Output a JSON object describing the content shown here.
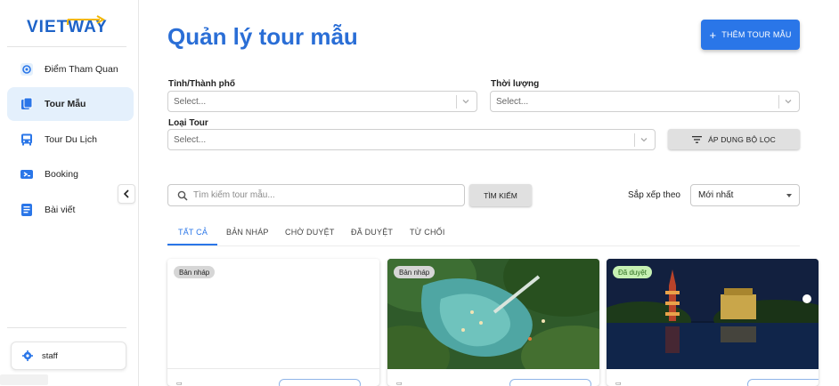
{
  "sidebar": {
    "logo_text": "VIETWAY",
    "items": [
      {
        "label": "Điểm Tham Quan",
        "icon": "attractions-icon",
        "active": false
      },
      {
        "label": "Tour Mẫu",
        "icon": "document-copy-icon",
        "active": true
      },
      {
        "label": "Tour Du Lịch",
        "icon": "bus-icon",
        "active": false
      },
      {
        "label": "Booking",
        "icon": "booking-ticket-icon",
        "active": false
      },
      {
        "label": "Bài viết",
        "icon": "article-icon",
        "active": false
      }
    ],
    "user_label": "staff"
  },
  "header": {
    "title": "Quản lý tour mẫu",
    "add_button_label": "THÊM TOUR MẪU"
  },
  "filters": {
    "province_label": "Tỉnh/Thành phố",
    "province_placeholder": "Select...",
    "duration_label": "Thời lượng",
    "duration_placeholder": "Select...",
    "tour_type_label": "Loại Tour",
    "tour_type_placeholder": "Select...",
    "apply_label": "ÁP DỤNG BỘ LỌC"
  },
  "search": {
    "placeholder": "Tìm kiếm tour mẫu...",
    "button_label": "TÌM KIẾM"
  },
  "sort": {
    "label": "Sắp xếp theo",
    "value": "Mới nhất"
  },
  "tabs": [
    {
      "label": "TẤT CẢ",
      "active": true
    },
    {
      "label": "BẢN NHÁP",
      "active": false
    },
    {
      "label": "CHỜ DUYỆT",
      "active": false
    },
    {
      "label": "ĐÃ DUYỆT",
      "active": false
    },
    {
      "label": "TỪ CHỐI",
      "active": false
    }
  ],
  "cards": [
    {
      "status": "Bản nháp",
      "status_type": "draft",
      "image": "blank"
    },
    {
      "status": "Bản nháp",
      "status_type": "draft",
      "image": "aerial-lagoon-forest"
    },
    {
      "status": "Đã duyệt",
      "status_type": "approved",
      "image": "pagoda-night-lake"
    }
  ],
  "colors": {
    "primary": "#2a76e8",
    "title": "#2a6ed6",
    "active_nav_bg": "#e4f0fc",
    "approved_badge": "#c6f0b3",
    "draft_badge": "#d6d6d6"
  }
}
